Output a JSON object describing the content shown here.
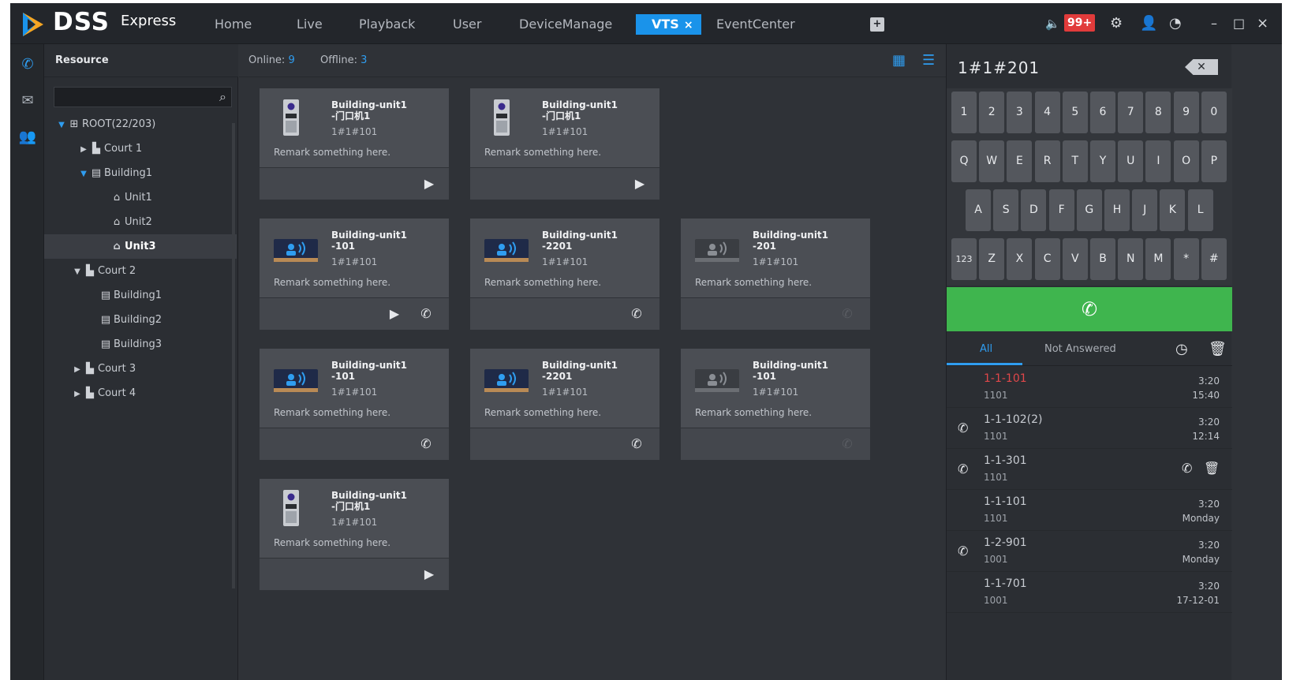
{
  "app": {
    "brand": "DSS",
    "brand_sub": "Express"
  },
  "nav": {
    "tabs": [
      {
        "label": "Home"
      },
      {
        "label": "Live"
      },
      {
        "label": "Playback"
      },
      {
        "label": "User"
      },
      {
        "label": "DeviceManage"
      },
      {
        "label": "VTS"
      },
      {
        "label": "EventCenter"
      }
    ],
    "active_tab_close": "×",
    "add_tab": "+",
    "notification_count": "99+"
  },
  "window_controls": {
    "minimize": "–",
    "maximize": "□",
    "close": "×"
  },
  "resource": {
    "header": "Resource",
    "search_placeholder": "",
    "tree": [
      {
        "label": "ROOT(22/203)"
      },
      {
        "label": "Court 1"
      },
      {
        "label": "Building1"
      },
      {
        "label": "Unit1"
      },
      {
        "label": "Unit2"
      },
      {
        "label": "Unit3"
      },
      {
        "label": "Court 2"
      },
      {
        "label": "Building1"
      },
      {
        "label": "Building2"
      },
      {
        "label": "Building3"
      },
      {
        "label": "Court 3"
      },
      {
        "label": "Court 4"
      }
    ]
  },
  "status": {
    "online_label": "Online:",
    "online_count": "9",
    "offline_label": "Offline:",
    "offline_count": "3"
  },
  "devices": [
    {
      "type": "door-station",
      "title_line1": "Building-unit1",
      "title_line2": "-门口机1",
      "number": "1#1#101",
      "remark": "Remark something here.",
      "online": true
    },
    {
      "type": "door-station",
      "title_line1": "Building-unit1",
      "title_line2": "-门口机1",
      "number": "1#1#101",
      "remark": "Remark something here.",
      "online": true
    },
    {
      "type": "indoor-monitor",
      "title_line1": "Building-unit1",
      "title_line2": "-101",
      "number": "1#1#101",
      "remark": "Remark something here.",
      "online": true
    },
    {
      "type": "indoor-monitor",
      "title_line1": "Building-unit1",
      "title_line2": "-2201",
      "number": "1#1#101",
      "remark": "Remark something here.",
      "online": true
    },
    {
      "type": "indoor-monitor",
      "title_line1": "Building-unit1",
      "title_line2": "-201",
      "number": "1#1#101",
      "remark": "Remark something here.",
      "online": false
    },
    {
      "type": "indoor-monitor",
      "title_line1": "Building-unit1",
      "title_line2": "-101",
      "number": "1#1#101",
      "remark": "Remark something here.",
      "online": true
    },
    {
      "type": "indoor-monitor",
      "title_line1": "Building-unit1",
      "title_line2": "-2201",
      "number": "1#1#101",
      "remark": "Remark something here.",
      "online": true
    },
    {
      "type": "indoor-monitor",
      "title_line1": "Building-unit1",
      "title_line2": "-101",
      "number": "1#1#101",
      "remark": "Remark something here.",
      "online": false
    },
    {
      "type": "door-station",
      "title_line1": "Building-unit1",
      "title_line2": "-门口机1",
      "number": "1#1#101",
      "remark": "Remark something here.",
      "online": true
    }
  ],
  "dialer": {
    "display": "1#1#201",
    "row1": [
      "1",
      "2",
      "3",
      "4",
      "5",
      "6",
      "7",
      "8",
      "9",
      "0"
    ],
    "row2": [
      "Q",
      "W",
      "E",
      "R",
      "T",
      "Y",
      "U",
      "I",
      "O",
      "P"
    ],
    "row3": [
      "A",
      "S",
      "D",
      "F",
      "G",
      "H",
      "J",
      "K",
      "L"
    ],
    "row4": [
      "123",
      "Z",
      "X",
      "C",
      "V",
      "B",
      "N",
      "M",
      "*",
      "#"
    ]
  },
  "call_tabs": {
    "all": "All",
    "not_answered": "Not Answered"
  },
  "call_records": [
    {
      "name": "1-1-101",
      "sub": "1101",
      "duration": "3:20",
      "time": "15:40",
      "missed": true,
      "icon": ""
    },
    {
      "name": "1-1-102(2)",
      "sub": "1101",
      "duration": "3:20",
      "time": "12:14",
      "missed": false,
      "icon": "outgoing-call-icon"
    },
    {
      "name": "1-1-301",
      "sub": "1101",
      "duration": "",
      "time": "",
      "missed": false,
      "icon": "outgoing-call-icon"
    },
    {
      "name": "1-1-101",
      "sub": "1101",
      "duration": "3:20",
      "time": "Monday",
      "missed": false,
      "icon": ""
    },
    {
      "name": "1-2-901",
      "sub": "1001",
      "duration": "3:20",
      "time": "Monday",
      "missed": false,
      "icon": "incoming-call-icon"
    },
    {
      "name": "1-1-701",
      "sub": "1001",
      "duration": "3:20",
      "time": "17-12-01",
      "missed": false,
      "icon": ""
    }
  ],
  "colors": {
    "accent": "#1a93ea",
    "call_green": "#3fb54e",
    "missed_red": "#e2474a"
  }
}
